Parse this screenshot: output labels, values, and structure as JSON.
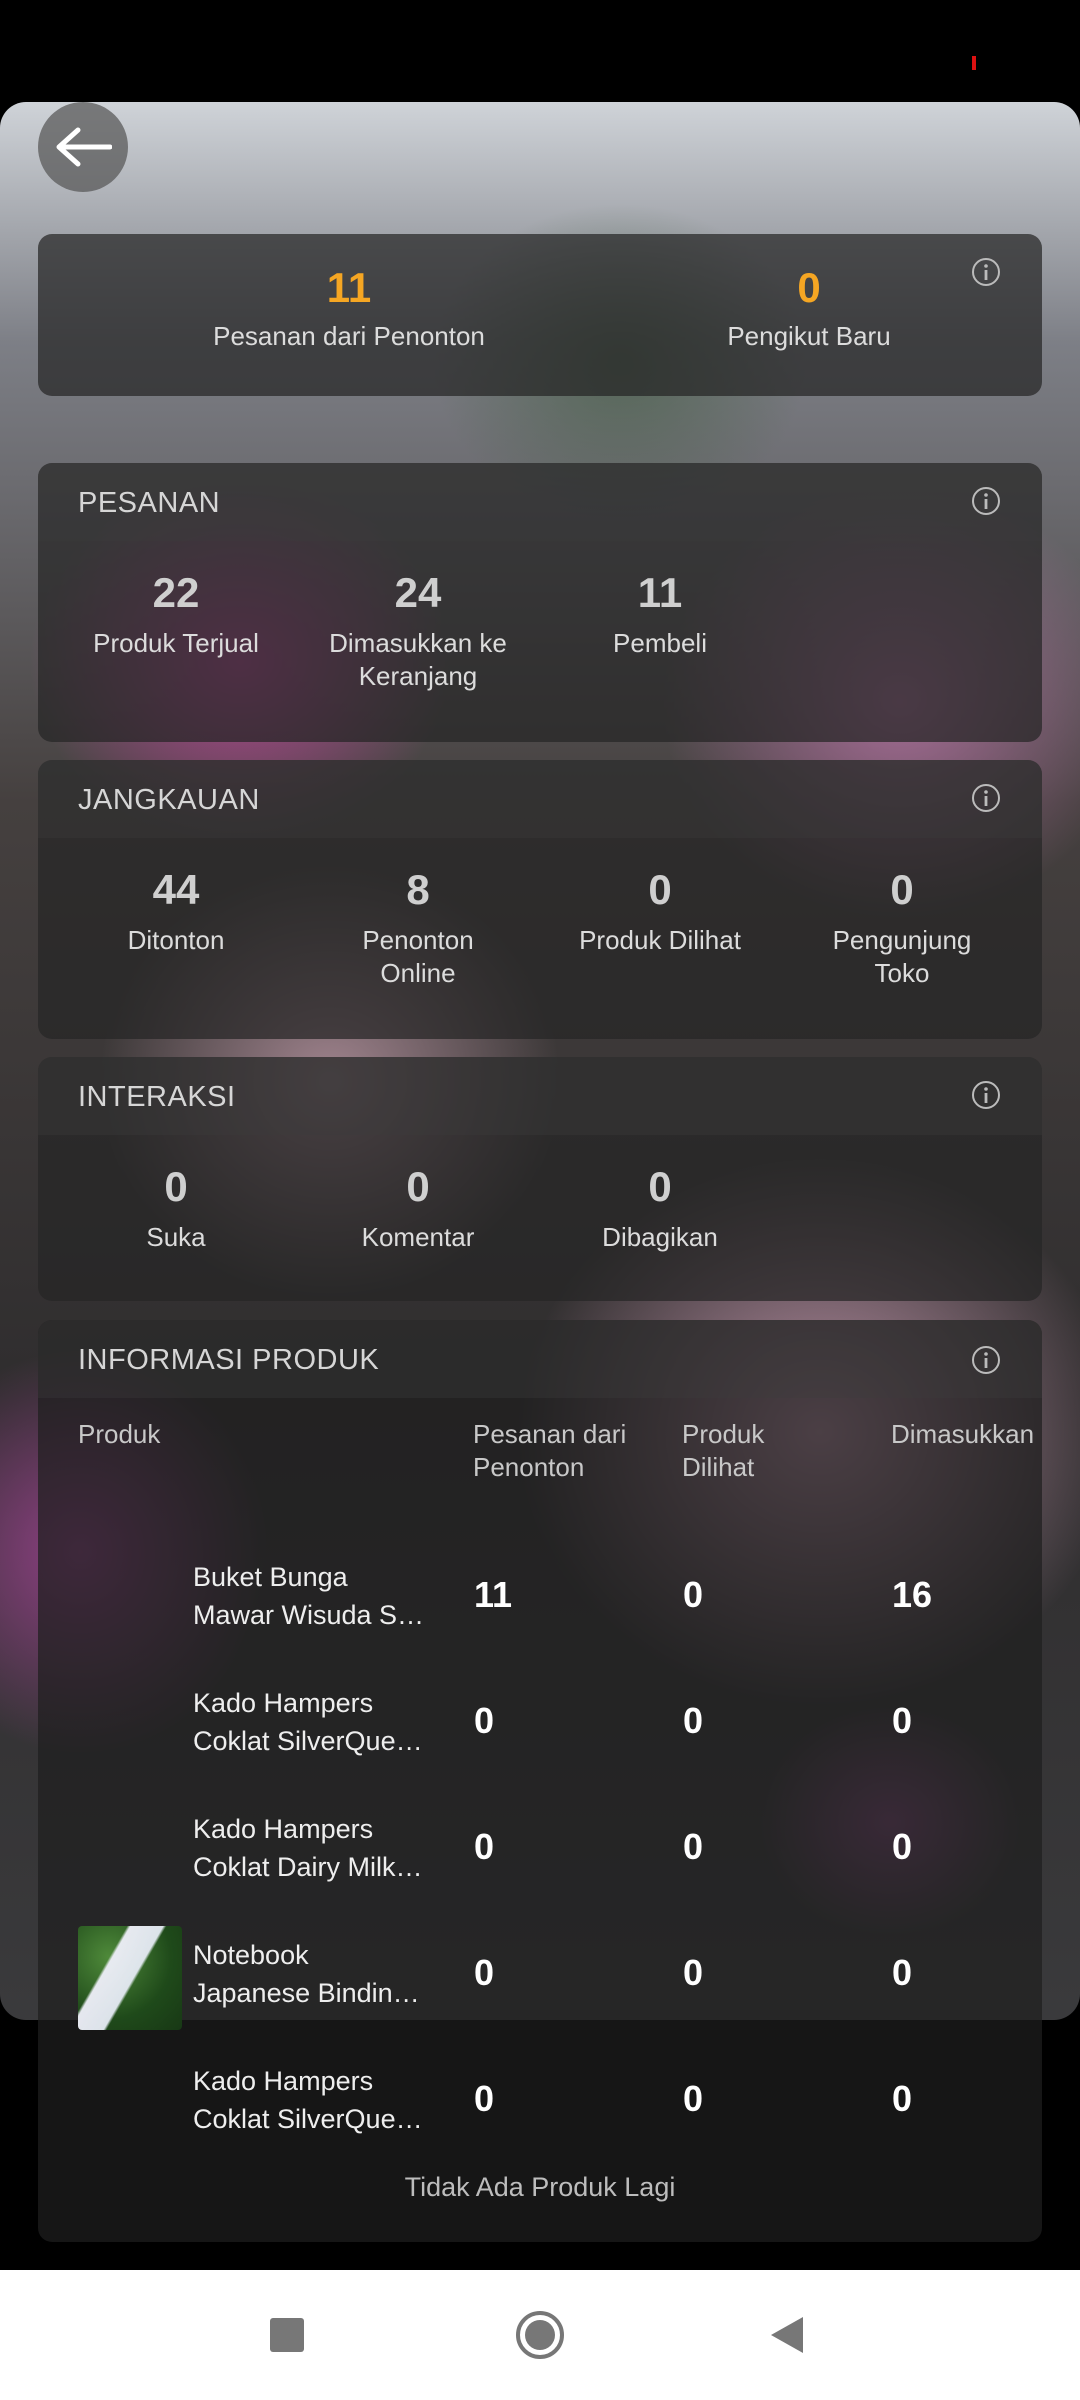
{
  "summary": {
    "orders_from_viewers": {
      "value": "11",
      "label": "Pesanan dari Penonton"
    },
    "new_followers": {
      "value": "0",
      "label": "Pengikut Baru"
    }
  },
  "orders": {
    "title": "PESANAN",
    "stats": [
      {
        "value": "22",
        "label": "Produk Terjual"
      },
      {
        "value": "24",
        "label": "Dimasukkan ke Keranjang"
      },
      {
        "value": "11",
        "label": "Pembeli"
      }
    ]
  },
  "reach": {
    "title": "JANGKAUAN",
    "stats": [
      {
        "value": "44",
        "label": "Ditonton"
      },
      {
        "value": "8",
        "label": "Penonton Online"
      },
      {
        "value": "0",
        "label": "Produk Dilihat"
      },
      {
        "value": "0",
        "label": "Pengunjung Toko"
      }
    ]
  },
  "interaction": {
    "title": "INTERAKSI",
    "stats": [
      {
        "value": "0",
        "label": "Suka"
      },
      {
        "value": "0",
        "label": "Komentar"
      },
      {
        "value": "0",
        "label": "Dibagikan"
      }
    ]
  },
  "product_info": {
    "title": "INFORMASI PRODUK",
    "columns": [
      "Produk",
      "Pesanan dari Penonton",
      "Produk Dilihat",
      "Dimasukkan ke Keranjang"
    ],
    "rows": [
      {
        "name": "Buket Bunga Mawar Wisuda S…",
        "orders": "11",
        "views": "0",
        "cart": "16"
      },
      {
        "name": "Kado Hampers Coklat SilverQue…",
        "orders": "0",
        "views": "0",
        "cart": "0"
      },
      {
        "name": "Kado Hampers Coklat Dairy Milk…",
        "orders": "0",
        "views": "0",
        "cart": "0"
      },
      {
        "name": "Notebook Japanese Bindin…",
        "orders": "0",
        "views": "0",
        "cart": "0"
      },
      {
        "name": "Kado Hampers Coklat SilverQue…",
        "orders": "0",
        "views": "0",
        "cart": "0"
      }
    ],
    "footer": "Tidak Ada Produk Lagi"
  },
  "colors": {
    "accent": "#f5a623"
  },
  "icons": {
    "back": "arrow-left-icon",
    "info": "info-icon",
    "recents": "square-icon",
    "home": "circle-icon",
    "back_nav": "triangle-icon"
  }
}
